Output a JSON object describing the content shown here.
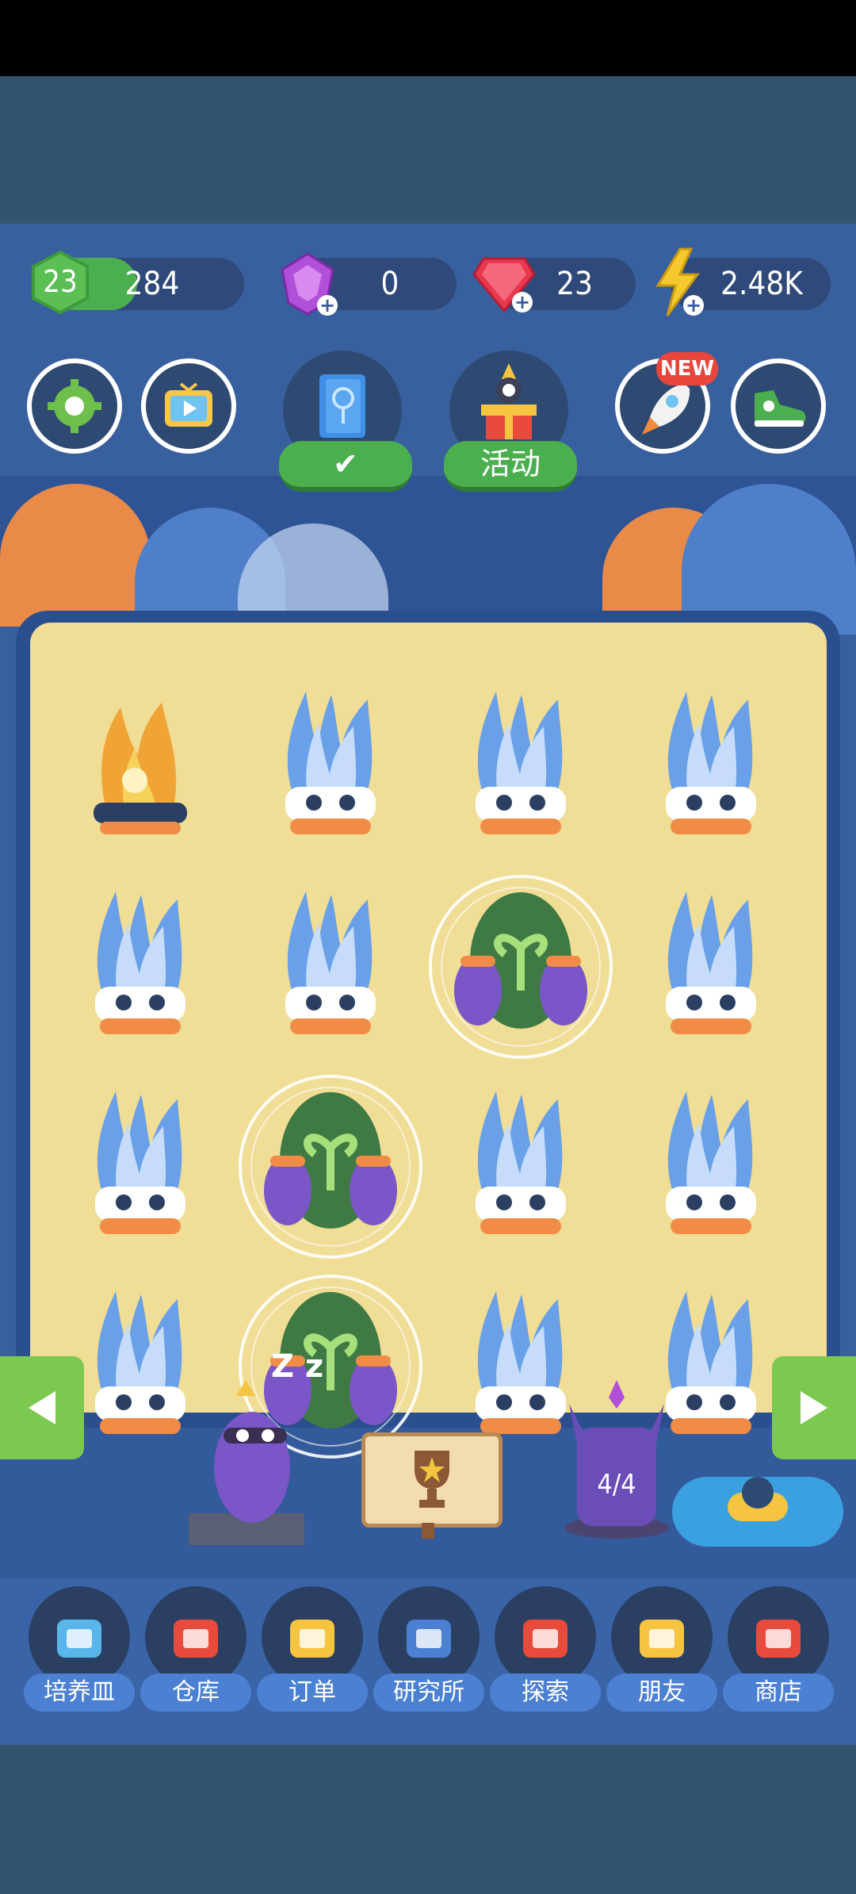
{
  "level": {
    "value": "23",
    "xp": "284",
    "xp_fraction": 0.45
  },
  "gems": {
    "value": "0"
  },
  "rubies": {
    "value": "23"
  },
  "energy": {
    "value": "2.48K"
  },
  "icons": {
    "settings": "gear-icon",
    "tv": "tv-play-icon",
    "book": "book-icon",
    "gift": "gift-icon",
    "rocket": "rocket-icon",
    "shoe": "sneaker-icon"
  },
  "top_buttons": {
    "activity_label": "活动",
    "rocket_badge": "NEW"
  },
  "board": {
    "statue_counter": "4/4",
    "rows": [
      [
        "fire-plant",
        "ice-plant",
        "ice-plant",
        "ice-plant"
      ],
      [
        "ice-plant",
        "ice-plant",
        "egg",
        "ice-plant"
      ],
      [
        "ice-plant",
        "egg",
        "ice-plant",
        "ice-plant"
      ],
      [
        "ice-plant",
        "egg",
        "ice-plant",
        "ice-plant"
      ]
    ]
  },
  "sleep_text": "Z z",
  "nav": [
    {
      "label": "培养皿",
      "icon": "petri-dish-icon"
    },
    {
      "label": "仓库",
      "icon": "barn-icon"
    },
    {
      "label": "订单",
      "icon": "order-list-icon"
    },
    {
      "label": "研究所",
      "icon": "lab-icon"
    },
    {
      "label": "探索",
      "icon": "hot-air-balloon-icon"
    },
    {
      "label": "朋友",
      "icon": "friends-icon"
    },
    {
      "label": "商店",
      "icon": "shop-icon"
    }
  ],
  "colors": {
    "accent_green": "#4caf4f",
    "board_sand": "#f0dd96",
    "ice_blue": "#6aa0e8"
  }
}
